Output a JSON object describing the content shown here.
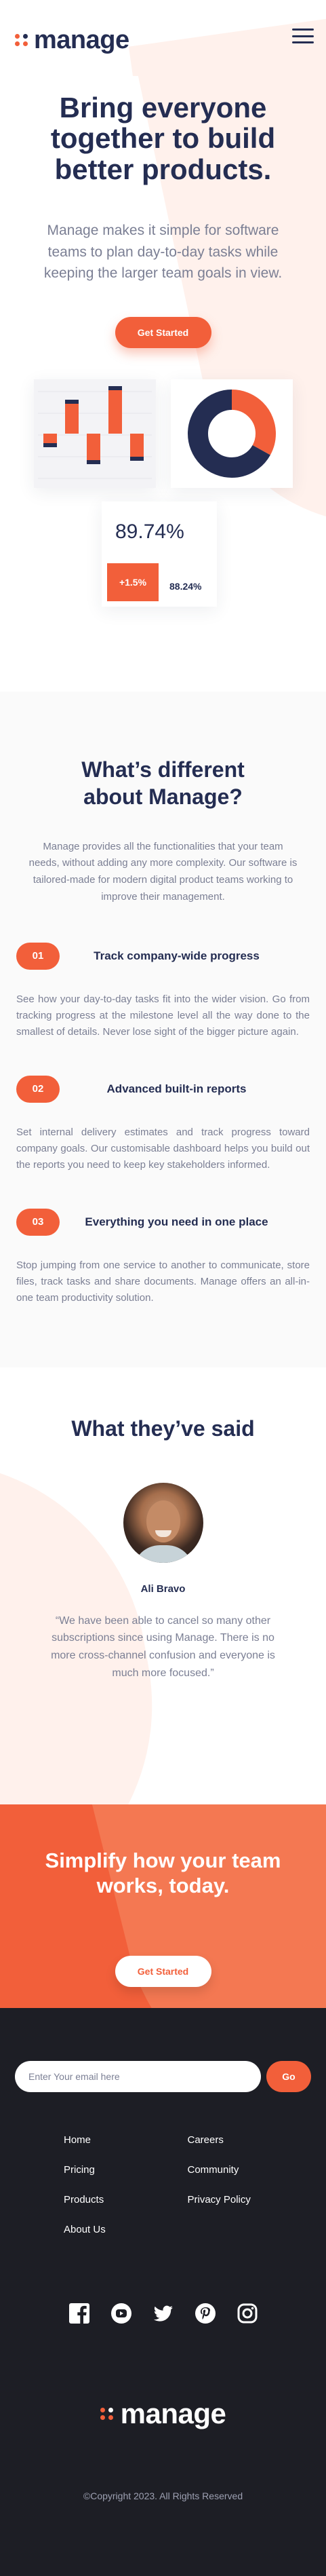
{
  "header": {
    "brand": "manage",
    "menu_icon": "hamburger-icon"
  },
  "hero": {
    "title": "Bring everyone together to build better products.",
    "subtitle": "Manage makes it simple for software teams to plan day-to-day tasks while keeping the larger team goals in view.",
    "cta_label": "Get Started",
    "stat": {
      "value": "89.74%",
      "badge": "+1.5%",
      "secondary": "88.24%"
    },
    "bars_chart": {
      "bars_from_midline": [
        -20,
        50,
        -45,
        70,
        -40
      ]
    },
    "donut_chart": {
      "segments": [
        0.33,
        0.67
      ]
    }
  },
  "colors": {
    "accent": "#f25f3a",
    "navy": "#242d52",
    "tint": "#fff1ec",
    "footer_bg": "#1d1e25"
  },
  "features": {
    "title": "What’s different about Manage?",
    "intro": "Manage provides all the functionalities that your team needs, without adding any more complexity. Our software is tailored-made for modern digital product teams working to improve their management.",
    "items": [
      {
        "num": "01",
        "title": "Track company-wide progress",
        "desc": "See how your day-to-day tasks fit into the wider vision. Go from tracking progress at the milestone level all the way done to the smallest of details. Never lose sight of the bigger picture again."
      },
      {
        "num": "02",
        "title": "Advanced built-in reports",
        "desc": "Set internal delivery estimates and track progress toward company goals. Our customisable dashboard helps you build out the reports you need to keep key stakeholders informed."
      },
      {
        "num": "03",
        "title": "Everything you need in one place",
        "desc": "Stop jumping from one service to another to communicate, store files, track tasks and share documents. Manage offers an all-in-one team productivity solution."
      }
    ]
  },
  "testimonials": {
    "title": "What they’ve said",
    "author": "Ali Bravo",
    "quote": "“We have been able to cancel so many other subscriptions since using Manage. There is no more cross-channel confusion and everyone is much more focused.”"
  },
  "cta": {
    "title": "Simplify how your team works, today.",
    "button": "Get Started"
  },
  "footer": {
    "email_placeholder": "Enter Your email here",
    "go_label": "Go",
    "links": [
      "Home",
      "Careers",
      "Pricing",
      "Community",
      "Products",
      "Privacy Policy",
      "About Us"
    ],
    "socials": [
      "facebook-icon",
      "youtube-icon",
      "twitter-icon",
      "pinterest-icon",
      "instagram-icon"
    ],
    "brand": "manage",
    "copyright": "©Copyright 2023. All Rights Reserved"
  }
}
